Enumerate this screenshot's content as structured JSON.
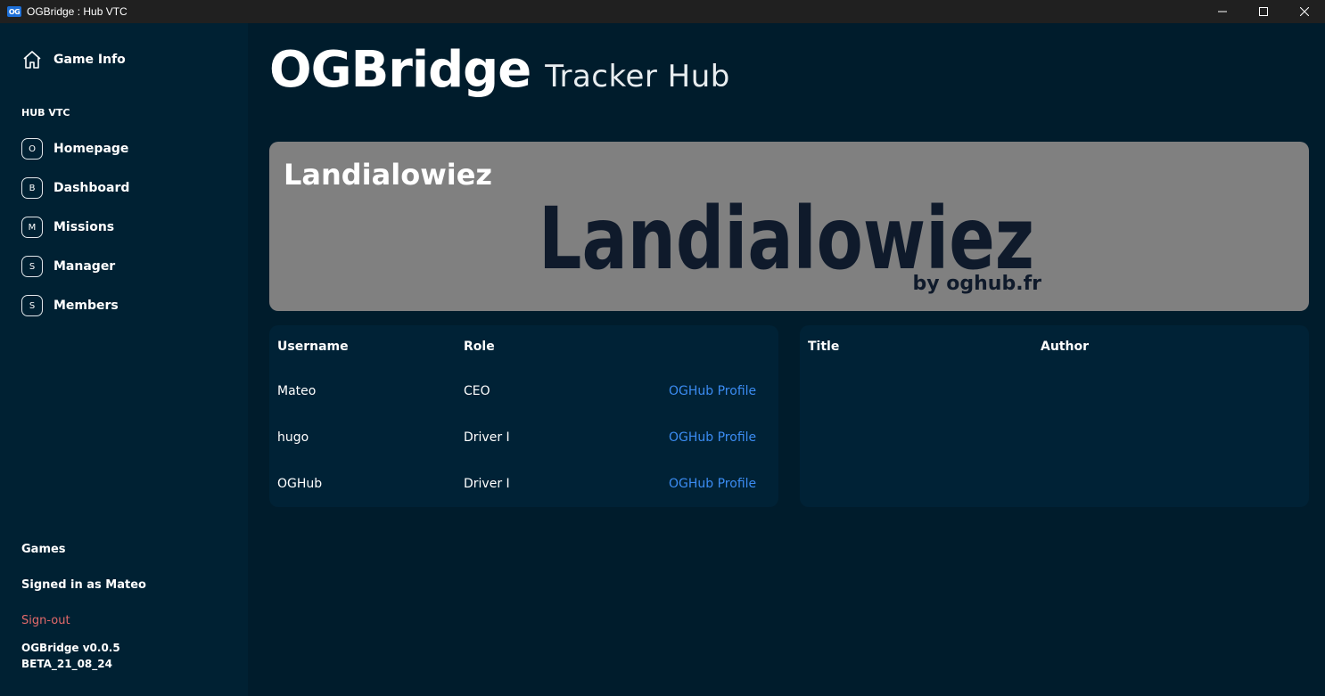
{
  "window": {
    "logo_text": "OG",
    "title": "OGBridge : Hub VTC",
    "minimize": "—",
    "maximize": "☐",
    "close": "✕"
  },
  "sidebar": {
    "game_info": "Game Info",
    "section_label": "HUB VTC",
    "items": [
      {
        "badge": "O",
        "label": "Homepage"
      },
      {
        "badge": "B",
        "label": "Dashboard"
      },
      {
        "badge": "M",
        "label": "Missions"
      },
      {
        "badge": "S",
        "label": "Manager"
      },
      {
        "badge": "S",
        "label": "Members"
      }
    ],
    "games": "Games",
    "signed_in": "Signed in as Mateo",
    "signout": "Sign-out",
    "version_line1": "OGBridge v0.0.5",
    "version_line2": "BETA_21_08_24"
  },
  "header": {
    "brand": "OGBridge",
    "subtitle": "Tracker Hub"
  },
  "banner": {
    "title": "Landialowiez",
    "logo_text": "Landialowiez",
    "logo_byline": "by oghub.fr"
  },
  "members_table": {
    "headers": [
      "Username",
      "Role"
    ],
    "rows": [
      {
        "username": "Mateo",
        "role": "CEO",
        "link": "OGHub Profile"
      },
      {
        "username": "hugo",
        "role": "Driver I",
        "link": "OGHub Profile"
      },
      {
        "username": "OGHub",
        "role": "Driver I",
        "link": "OGHub Profile"
      }
    ]
  },
  "posts_table": {
    "headers": [
      "Title",
      "Author"
    ]
  },
  "colors": {
    "background": "#001c2c",
    "sidebar": "#002133",
    "panel": "#002236",
    "banner": "#808080",
    "link": "#3b8cf2",
    "signout": "#e36a6a"
  }
}
